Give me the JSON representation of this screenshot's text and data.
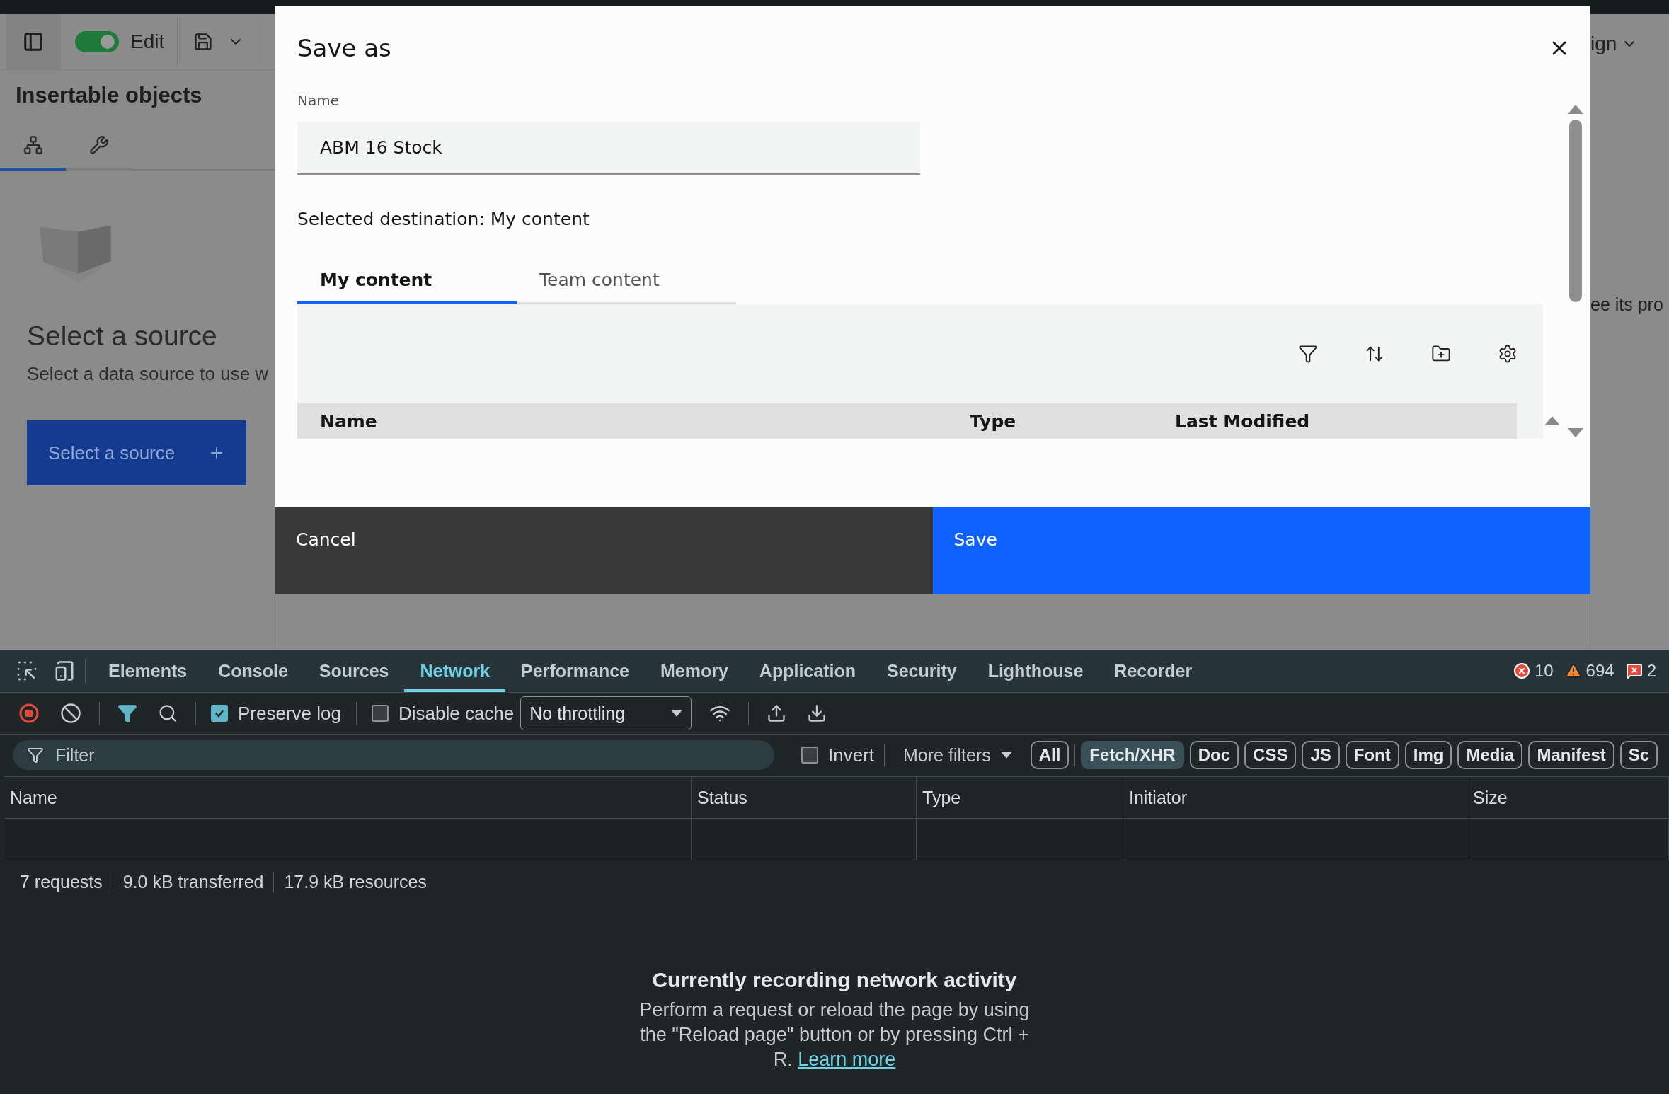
{
  "app": {
    "toolbar": {
      "edit_toggle": {
        "label": "Edit",
        "on": true
      }
    },
    "panel_title": "Insertable objects",
    "panel_tabs": [
      {
        "kind": "tree",
        "selected": true
      },
      {
        "kind": "wrench",
        "selected": false
      }
    ],
    "empty_state": {
      "title": "Select a source",
      "text": "Select a data source to use w",
      "button": "Select a source"
    },
    "right_fragments": {
      "menu": "ign",
      "text": "ee its pro"
    }
  },
  "dialog": {
    "title": "Save as",
    "name_label": "Name",
    "name_value": "ABM 16 Stock",
    "destination": "Selected destination: My content",
    "tabs": [
      {
        "label": "My content",
        "selected": true
      },
      {
        "label": "Team content",
        "selected": false
      }
    ],
    "columns": [
      "Name",
      "Type",
      "Last Modified"
    ],
    "buttons": [
      {
        "label": "Cancel",
        "kind": "secondary"
      },
      {
        "label": "Save",
        "kind": "primary"
      }
    ]
  },
  "devtools": {
    "tabs": [
      {
        "label": "Elements",
        "selected": false
      },
      {
        "label": "Console",
        "selected": false
      },
      {
        "label": "Sources",
        "selected": false
      },
      {
        "label": "Network",
        "selected": true
      },
      {
        "label": "Performance",
        "selected": false
      },
      {
        "label": "Memory",
        "selected": false
      },
      {
        "label": "Application",
        "selected": false
      },
      {
        "label": "Security",
        "selected": false
      },
      {
        "label": "Lighthouse",
        "selected": false
      },
      {
        "label": "Recorder",
        "selected": false
      }
    ],
    "counts": {
      "errors": "10",
      "warnings": "694",
      "issues": "2"
    },
    "toolbar": {
      "preserve_log": {
        "label": "Preserve log",
        "checked": true
      },
      "disable_cache": {
        "label": "Disable cache",
        "checked": false
      },
      "throttling": "No throttling"
    },
    "filter": {
      "placeholder": "Filter",
      "invert": {
        "label": "Invert",
        "checked": false
      },
      "more_filters": "More filters",
      "types": [
        {
          "label": "All",
          "selected": false
        },
        {
          "label": "Fetch/XHR",
          "selected": true
        },
        {
          "label": "Doc",
          "selected": false
        },
        {
          "label": "CSS",
          "selected": false
        },
        {
          "label": "JS",
          "selected": false
        },
        {
          "label": "Font",
          "selected": false
        },
        {
          "label": "Img",
          "selected": false
        },
        {
          "label": "Media",
          "selected": false
        },
        {
          "label": "Manifest",
          "selected": false
        },
        {
          "label": "Sc",
          "selected": false
        }
      ]
    },
    "table": {
      "columns": [
        "Name",
        "Status",
        "Type",
        "Initiator",
        "Size"
      ]
    },
    "summary": [
      "7 requests",
      "9.0 kB transferred",
      "17.9 kB resources"
    ],
    "empty": {
      "title": "Currently recording network activity",
      "text": "Perform a request or reload the page by using the \"Reload page\" button or by pressing Ctrl + R.",
      "link": "Learn more"
    }
  }
}
